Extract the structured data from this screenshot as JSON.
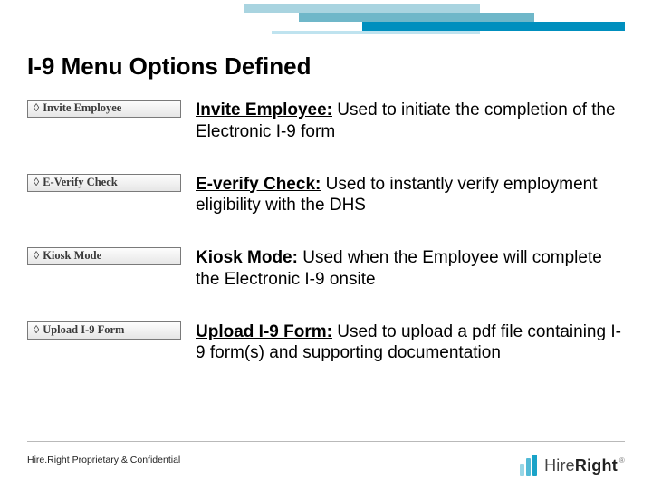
{
  "title": "I-9 Menu Options Defined",
  "rows": [
    {
      "button": "Invite Employee",
      "lead": "Invite Employee:",
      "body": " Used to initiate the completion of the Electronic I-9 form"
    },
    {
      "button": "E-Verify Check",
      "lead": "E-verify Check:",
      "body": "  Used to instantly verify employment eligibility with the DHS"
    },
    {
      "button": "Kiosk Mode",
      "lead": "Kiosk Mode:",
      "body": "  Used when the Employee will complete the Electronic I-9 onsite"
    },
    {
      "button": "Upload I-9 Form",
      "lead": "Upload I-9 Form:",
      "body": " Used to upload a pdf file containing I-9 form(s) and supporting documentation"
    }
  ],
  "footer": "Hire.Right Proprietary & Confidential",
  "brand": {
    "left": "Hire",
    "right": "Right"
  },
  "glyphs": {
    "chevron": "◊",
    "registered": "®"
  }
}
